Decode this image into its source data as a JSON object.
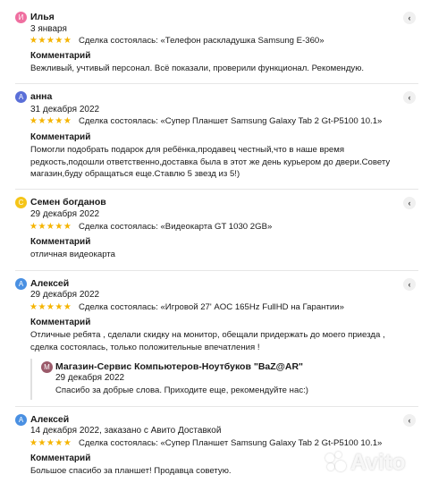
{
  "more_icon_glyph": "‹",
  "stars": "★★★★★",
  "comment_title": "Комментарий",
  "reviews": [
    {
      "avatar_letter": "И",
      "avatar_color": "#ef6fa0",
      "name": "Илья",
      "date": "3 января",
      "deal": "Сделка состоялась: «Телефон раскладушка Samsung E-360»",
      "comment": "Вежливый, учтивый персонал. Всё показали, проверили функционал. Рекомендую."
    },
    {
      "avatar_letter": "А",
      "avatar_color": "#5a6fd8",
      "name": "анна",
      "date": "31 декабря 2022",
      "deal": "Сделка состоялась: «Супер Планшет Samsung Galaxy Tab 2 Gt-P5100 10.1»",
      "comment": "Помогли подобрать подарок для ребёнка,продавец честный,что в наше время редкость,подошли ответственно,доставка была в этот же день курьером до двери.Совету магазин,буду обращаться еще.Ставлю 5 звезд из 5!)"
    },
    {
      "avatar_letter": "С",
      "avatar_color": "#f5c518",
      "name": "Семен богданов",
      "date": "29 декабря 2022",
      "deal": "Сделка состоялась: «Видеокарта GT 1030 2GB»",
      "comment": "отличная видеокарта"
    },
    {
      "avatar_letter": "А",
      "avatar_color": "#4a90e2",
      "name": "Алексей",
      "date": "29 декабря 2022",
      "deal": "Сделка состоялась: «Игровой 27' AOC 165Hz FullHD на Гарантии»",
      "comment": "Отличные ребята , сделали скидку на монитор, обещали придержать до моего приезда , сделка состоялась, только положительные впечатления !",
      "reply": {
        "avatar_letter": "М",
        "avatar_color": "#9b5a6a",
        "name": "Магазин-Сервис Компьютеров-Ноутбуков \"BaZ@AR\"",
        "date": "29 декабря 2022",
        "text": "Спасибо за добрые слова. Приходите еще, рекомендуйте нас:)"
      }
    },
    {
      "avatar_letter": "А",
      "avatar_color": "#4a90e2",
      "name": "Алексей",
      "date": "14 декабря 2022, заказано с Авито Доставкой",
      "deal": "Сделка состоялась: «Супер Планшет Samsung Galaxy Tab 2 Gt-P5100 10.1»",
      "comment": "Большое спасибо за планшет! Продавца советую."
    }
  ],
  "watermark": "Avito"
}
